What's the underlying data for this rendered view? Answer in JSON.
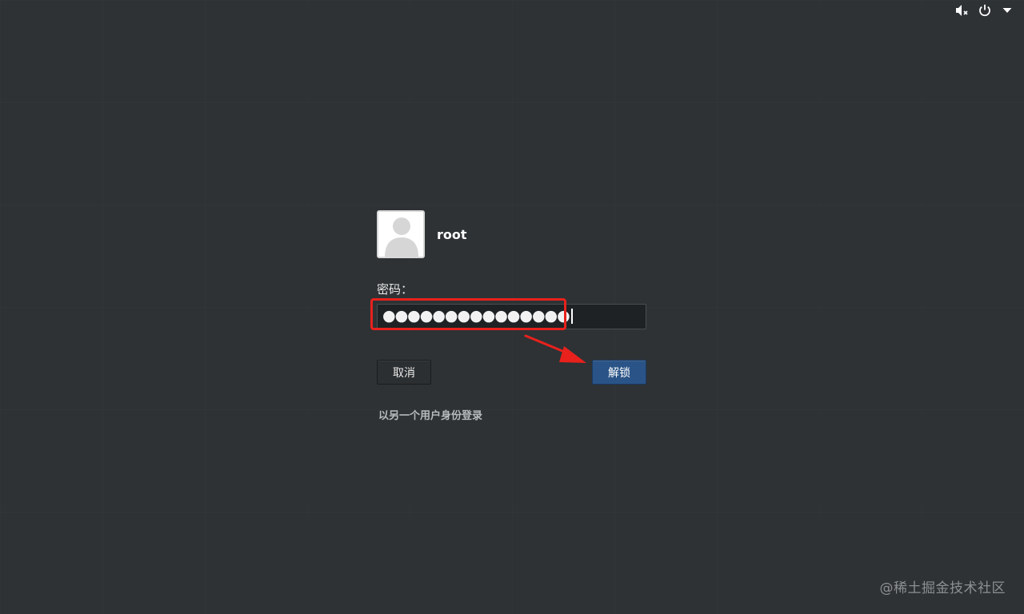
{
  "topbar": {
    "volume_icon": "volume-muted-icon",
    "power_icon": "power-icon",
    "menu_icon": "chevron-down-icon"
  },
  "login": {
    "username": "root",
    "password_label": "密码：",
    "password_masked": "●●●●●●●●●●●●●●●",
    "cancel_label": "取消",
    "unlock_label": "解锁",
    "other_user_link": "以另一个用户身份登录"
  },
  "watermark": "@稀土掘金技术社区",
  "colors": {
    "background": "#2e3235",
    "unlock_button": "#2a5487",
    "annotation_red": "#e8211c"
  }
}
